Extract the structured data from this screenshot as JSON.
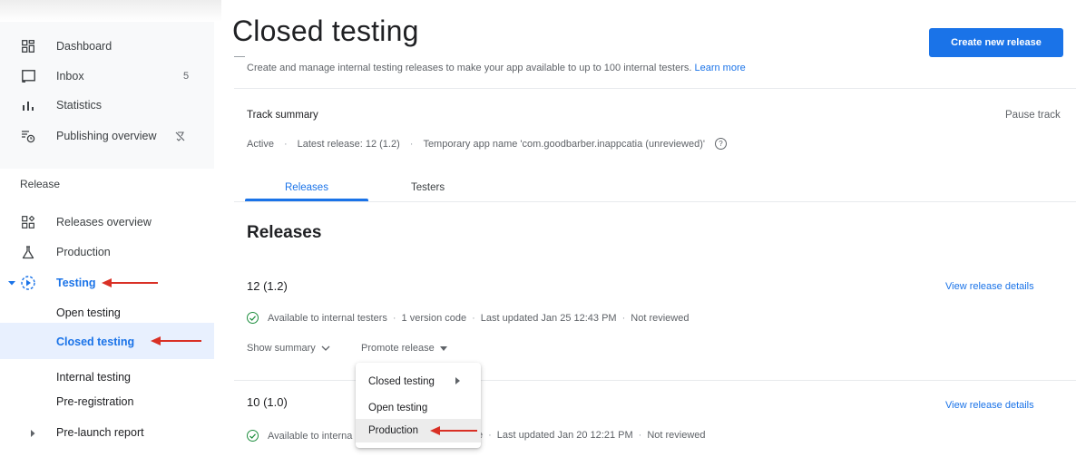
{
  "sidebar": {
    "items": [
      {
        "label": "Dashboard",
        "icon": "dashboard-icon"
      },
      {
        "label": "Inbox",
        "icon": "inbox-icon",
        "badge": "5"
      },
      {
        "label": "Statistics",
        "icon": "statistics-icon"
      },
      {
        "label": "Publishing overview",
        "icon": "publishing-overview-icon",
        "trailing_icon": "managed-publishing-off-icon"
      }
    ],
    "release_heading": "Release",
    "release_items": [
      {
        "label": "Releases overview",
        "icon": "releases-overview-icon"
      },
      {
        "label": "Production",
        "icon": "production-icon"
      },
      {
        "label": "Testing",
        "icon": "testing-icon"
      }
    ],
    "testing_subitems": [
      {
        "label": "Open testing"
      },
      {
        "label": "Closed testing",
        "active": true
      },
      {
        "label": "Internal testing"
      },
      {
        "label": "Pre-registration"
      }
    ],
    "prelaunch": {
      "label": "Pre-launch report"
    }
  },
  "page": {
    "title": "Closed testing",
    "description": "Create and manage internal testing releases to make your app available to up to 100 internal testers.",
    "learn_more": "Learn more",
    "create_button": "Create new release"
  },
  "track_summary": {
    "title": "Track summary",
    "pause": "Pause track",
    "status": "Active",
    "latest_release": "Latest release: 12 (1.2)",
    "app_name": "Temporary app name 'com.goodbarber.inappcatia (unreviewed)'"
  },
  "tabs": [
    {
      "label": "Releases",
      "active": true
    },
    {
      "label": "Testers",
      "active": false
    }
  ],
  "releases": {
    "heading": "Releases",
    "view_details": "View release details",
    "items": [
      {
        "version": "12 (1.2)",
        "availability": "Available to internal testers",
        "version_codes": "1 version code",
        "updated": "Last updated Jan 25 12:43 PM",
        "review": "Not reviewed"
      },
      {
        "version": "10 (1.0)",
        "availability": "Available to interna",
        "updated": "Last updated Jan 20 12:21 PM",
        "review": "Not reviewed"
      }
    ],
    "show_summary": "Show summary",
    "promote_release": "Promote release"
  },
  "promote_menu": {
    "items": [
      {
        "label": "Closed testing",
        "submenu": true
      },
      {
        "label": "Open testing"
      },
      {
        "label": "Production",
        "highlighted": true
      }
    ]
  },
  "colors": {
    "accent": "#1a73e8",
    "active_bg": "#e8f0fe",
    "annotation_arrow": "#d93025",
    "success": "#1e8e3e"
  }
}
